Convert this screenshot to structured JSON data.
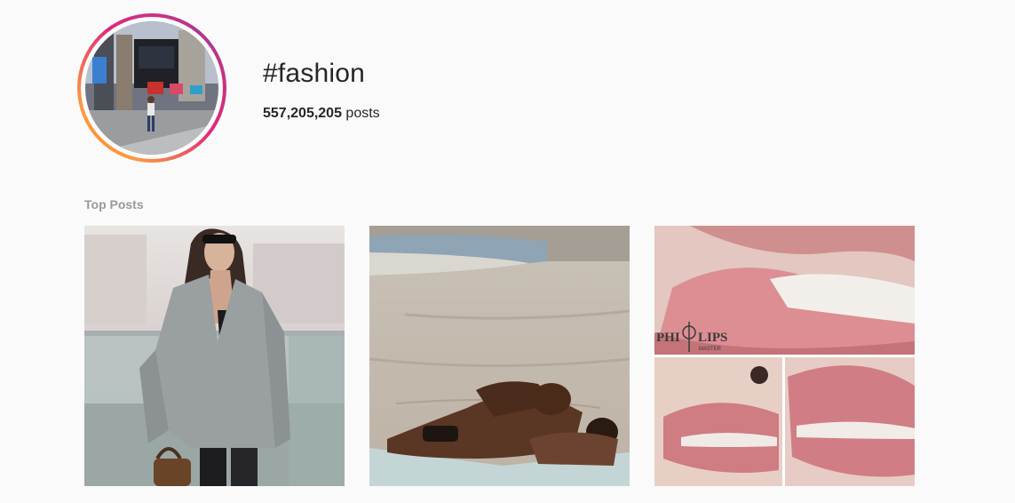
{
  "hashtag": {
    "title": "#fashion",
    "post_count": "557,205,205",
    "post_count_suffix": " posts"
  },
  "top_posts": {
    "section_title": "Top Posts",
    "posts": [
      {
        "subject": "woman-in-grey-blazer-photo"
      },
      {
        "subject": "couple-on-beach-photo"
      },
      {
        "subject": "lips-closeup-photo",
        "overlay_text": "PHI",
        "overlay_text_2": "LIPS",
        "overlay_small": "MASTER"
      }
    ]
  },
  "colors": {
    "background": "#fafafa",
    "text": "#262626",
    "muted": "#999999",
    "ring_start": "#f58529",
    "ring_end": "#8134af"
  }
}
